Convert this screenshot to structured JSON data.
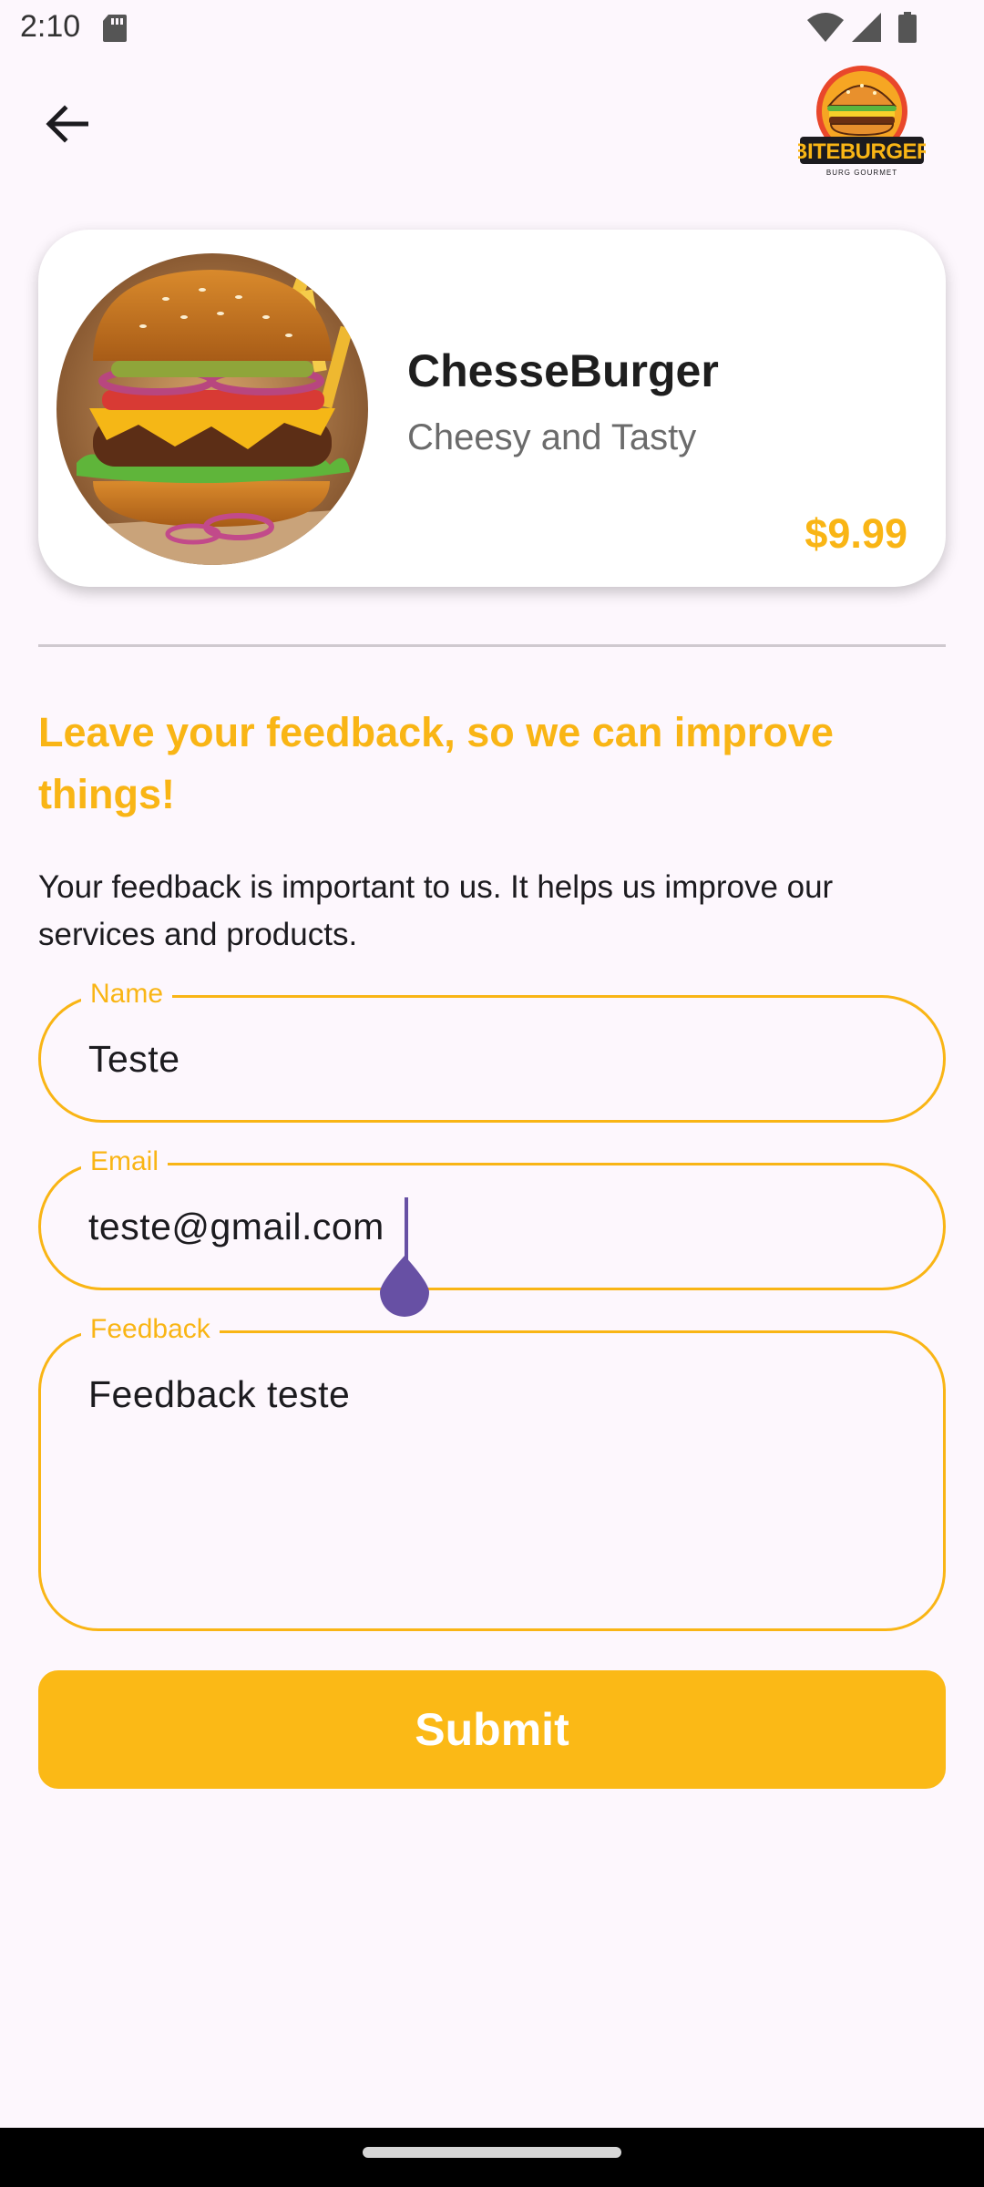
{
  "status_bar": {
    "time": "2:10"
  },
  "brand": {
    "logo_text": "BITEBURGER",
    "logo_tagline": "BURG GOURMET"
  },
  "product": {
    "name": "ChesseBurger",
    "subtitle": "Cheesy and Tasty",
    "price": "$9.99",
    "image_alt": "cheeseburger-photo"
  },
  "feedback": {
    "title": "Leave your feedback, so we can improve things!",
    "description": "Your feedback is important to us. It helps us improve our services and products."
  },
  "form": {
    "name_label": "Name",
    "name_value": "Teste",
    "email_label": "Email",
    "email_value": "teste@gmail.com",
    "feedback_label": "Feedback",
    "feedback_value": "Feedback teste",
    "submit_label": "Submit"
  },
  "colors": {
    "accent": "#f9b515",
    "background": "#fdf7fd",
    "cursor": "#6750a4"
  }
}
